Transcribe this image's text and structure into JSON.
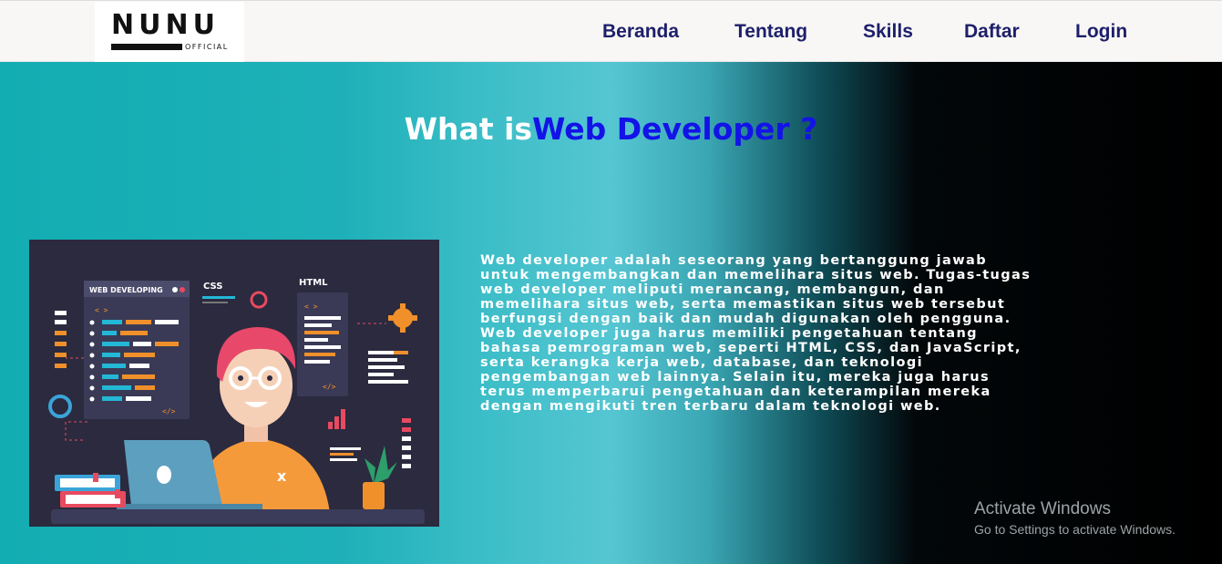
{
  "logo": {
    "name": "NUNU",
    "sub": "OFFICIAL"
  },
  "nav": {
    "items": [
      "Beranda",
      "Tentang",
      "Skills",
      "Daftar",
      "Login"
    ]
  },
  "hero": {
    "title_prefix": "What is",
    "title_highlight": "Web Developer ?",
    "description": "Web developer adalah seseorang yang bertanggung jawab untuk mengembangkan dan memelihara situs web. Tugas-tugas web developer meliputi merancang, membangun, dan memelihara situs web, serta memastikan situs web tersebut berfungsi dengan baik dan mudah digunakan oleh pengguna. Web developer juga harus memiliki pengetahuan tentang bahasa pemrograman web, seperti HTML, CSS, dan JavaScript, serta kerangka kerja web, database, dan teknologi pengembangan web lainnya. Selain itu, mereka juga harus terus memperbarui pengetahuan dan keterampilan mereka dengan mengikuti tren terbaru dalam teknologi web."
  },
  "illustration": {
    "panel_title": "WEB DEVELOPING",
    "label_css": "CSS",
    "label_html": "HTML",
    "tag_open": "< >",
    "tag_close": "</>"
  },
  "watermark": {
    "title": "Activate Windows",
    "subtitle": "Go to Settings to activate Windows."
  },
  "colors": {
    "nav_text": "#1e1f6b",
    "title_highlight": "#1313e8",
    "hero_left": "#12adb2",
    "hero_right": "#000000"
  }
}
